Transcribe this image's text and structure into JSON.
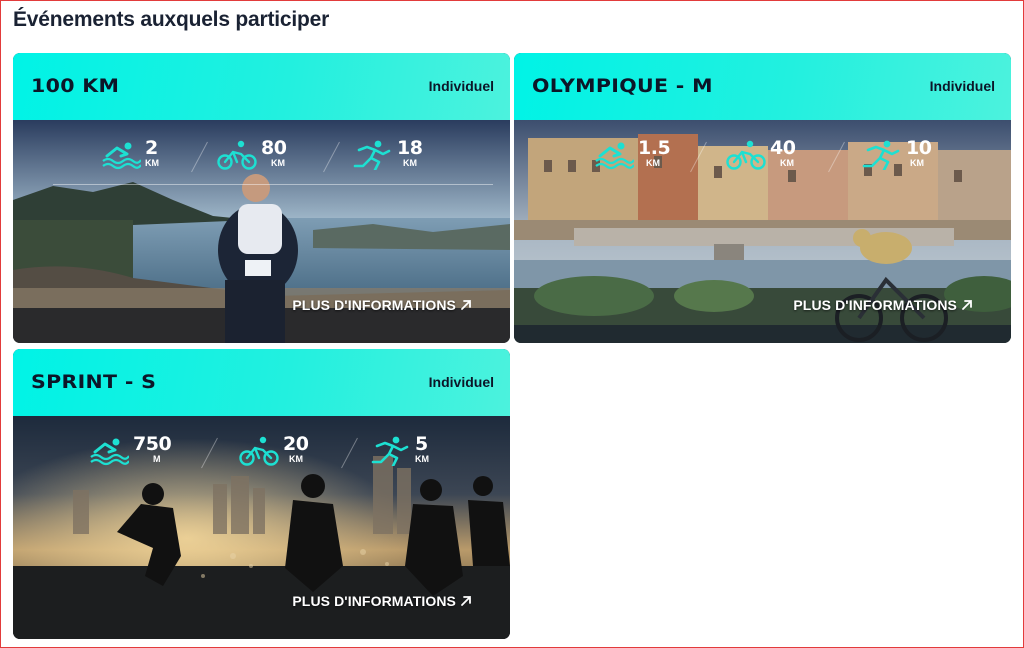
{
  "section": {
    "title": "Événements auxquels participer"
  },
  "colors": {
    "accent": "#00f3e6",
    "text_dark": "#0c1628",
    "frame": "#e23b3b"
  },
  "icons": {
    "swim": "swim-icon",
    "bike": "bike-icon",
    "run": "run-icon",
    "arrow": "arrow-up-right-icon"
  },
  "events": [
    {
      "title": "100 KM",
      "type": "Individuel",
      "stats": [
        {
          "value": "2",
          "unit": "KM"
        },
        {
          "value": "80",
          "unit": "KM"
        },
        {
          "value": "18",
          "unit": "KM"
        }
      ],
      "link_label": "PLUS D'INFORMATIONS"
    },
    {
      "title": "OLYMPIQUE - M",
      "type": "Individuel",
      "stats": [
        {
          "value": "1.5",
          "unit": "KM"
        },
        {
          "value": "40",
          "unit": "KM"
        },
        {
          "value": "10",
          "unit": "KM"
        }
      ],
      "link_label": "PLUS D'INFORMATIONS"
    },
    {
      "title": "SPRINT - S",
      "type": "Individuel",
      "stats": [
        {
          "value": "750",
          "unit": "M"
        },
        {
          "value": "20",
          "unit": "KM"
        },
        {
          "value": "5",
          "unit": "KM"
        }
      ],
      "link_label": "PLUS D'INFORMATIONS"
    }
  ]
}
